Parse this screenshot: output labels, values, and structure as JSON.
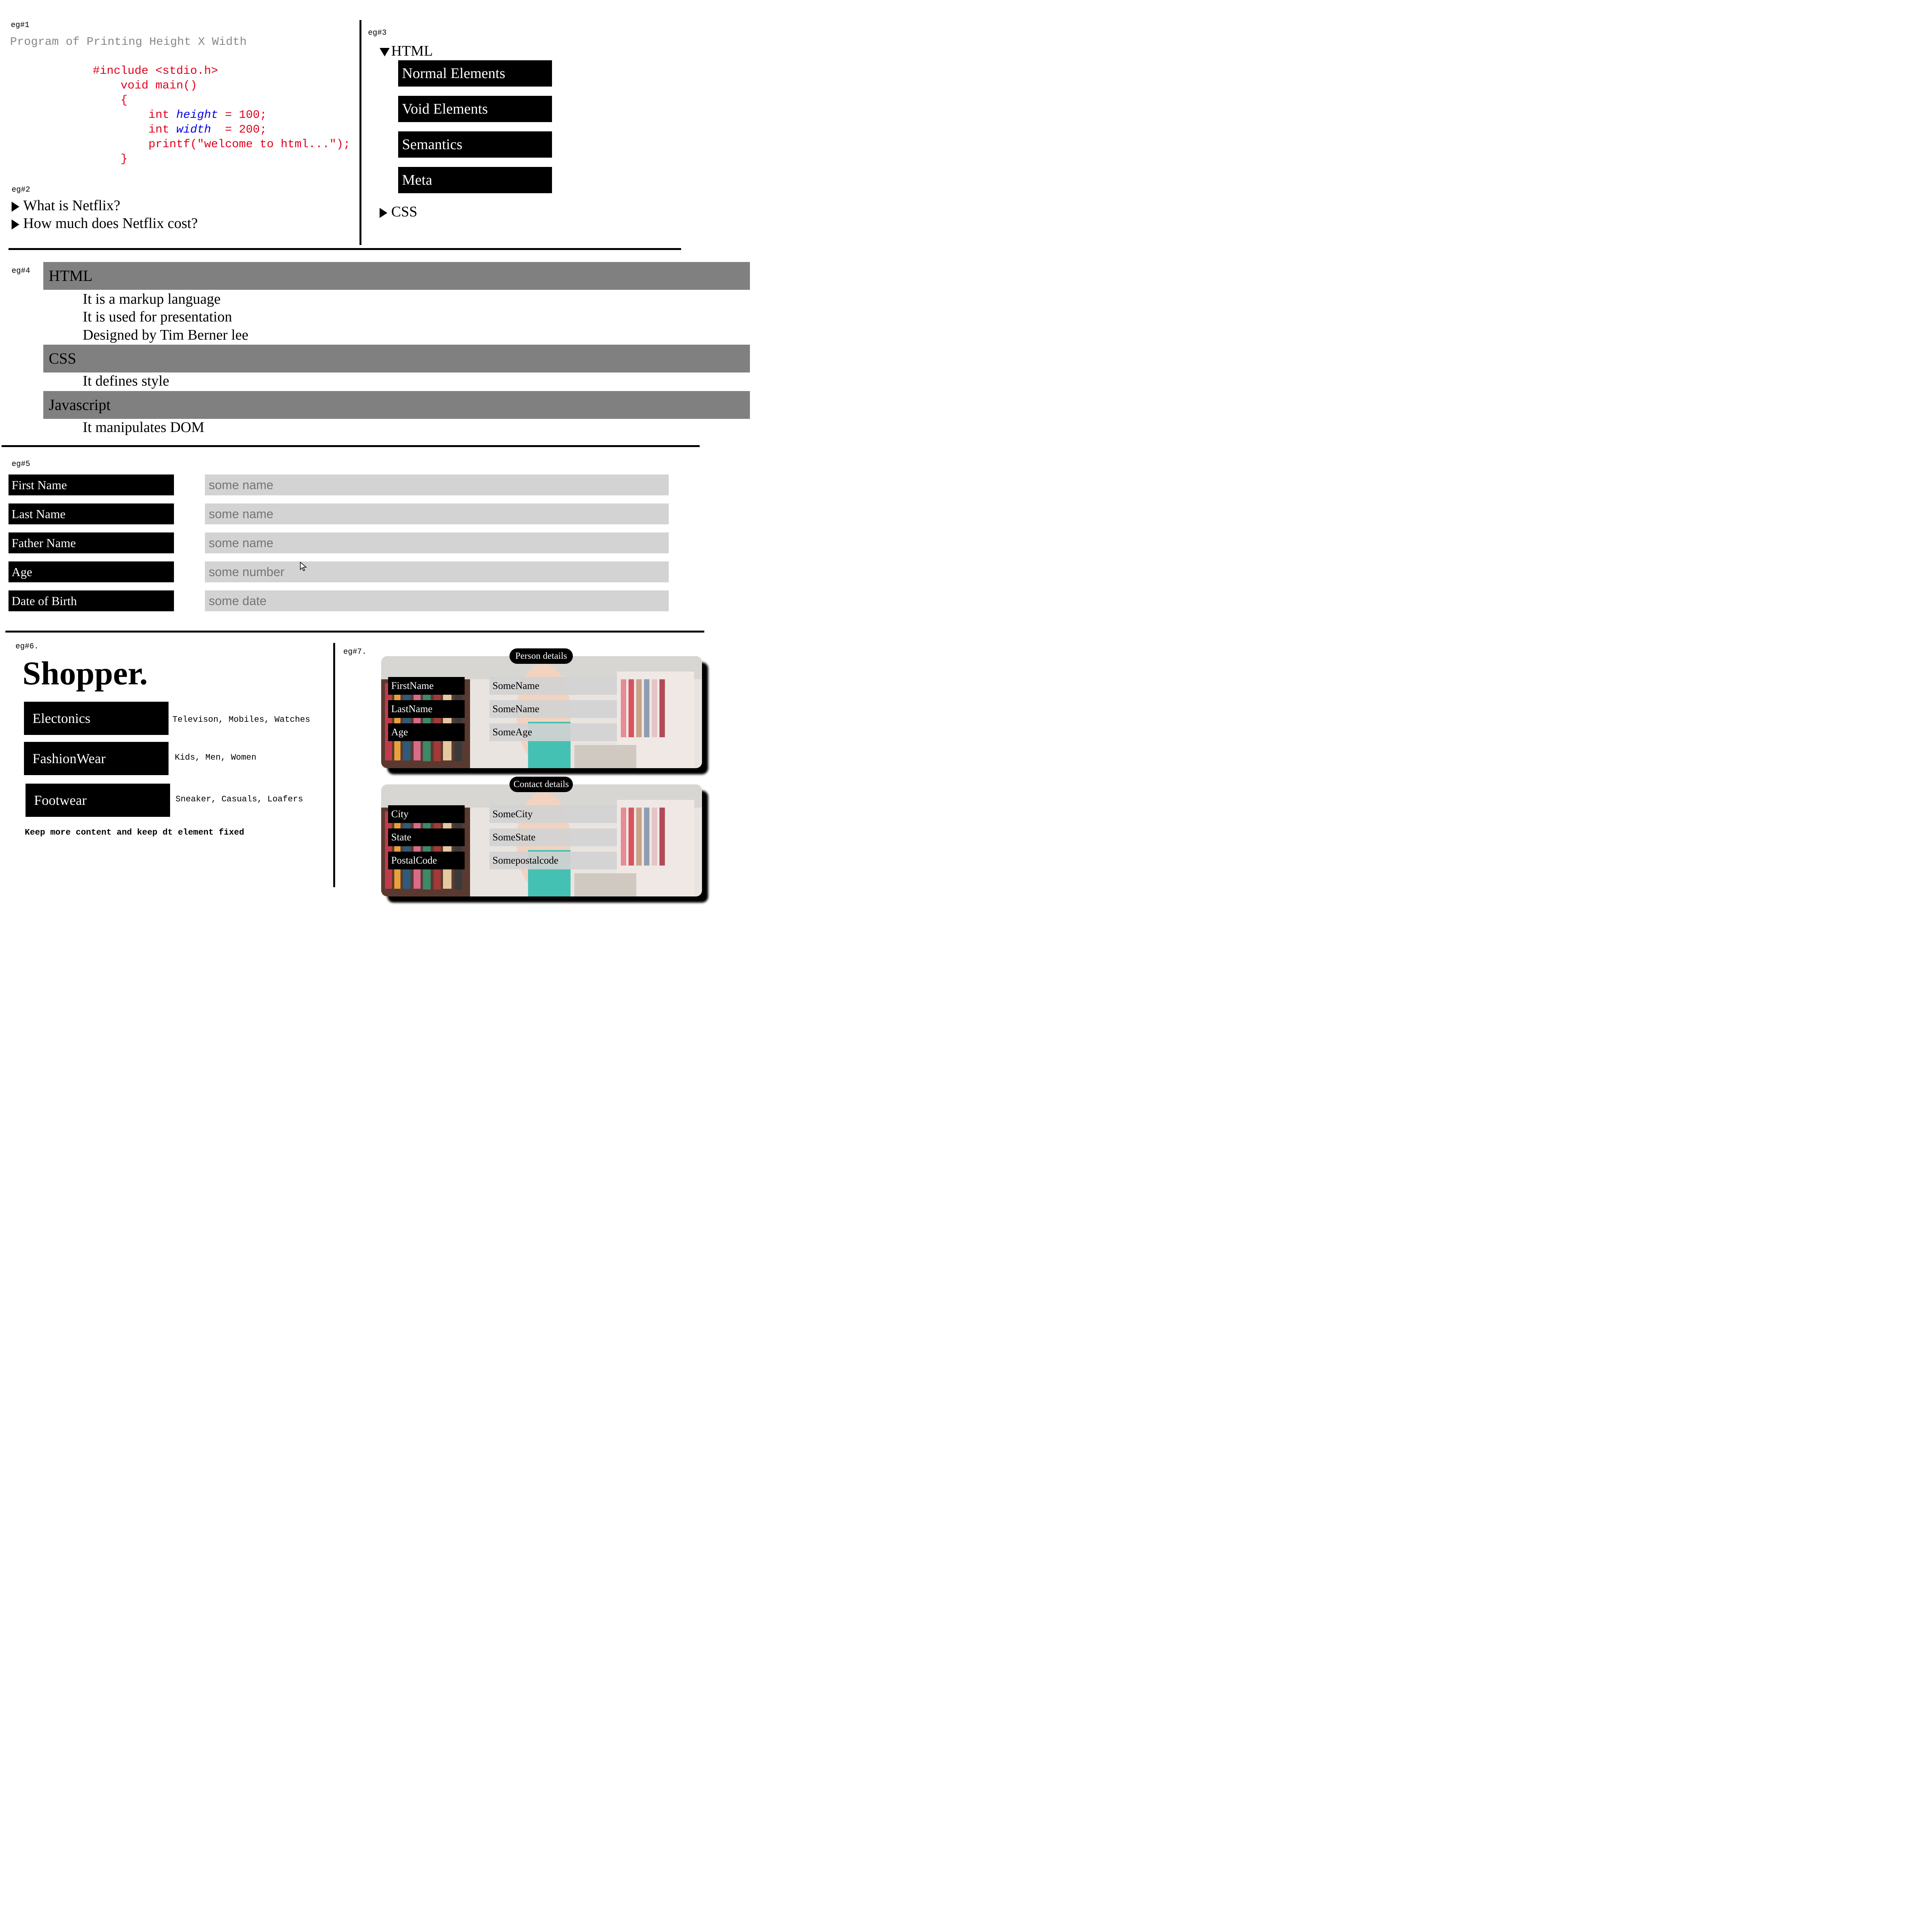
{
  "eg1": {
    "tag": "eg#1",
    "title": "Program of Printing Height X Width",
    "code": {
      "include": "#include <stdio.h>",
      "main": "void main()",
      "open": "{",
      "h_kw": "int ",
      "h_var": "height",
      "h_rest": " = 100;",
      "w_kw": "int ",
      "w_var": "width",
      "w_rest": "  = 200;",
      "printf": "printf(\"welcome to html...\");",
      "close": "}"
    }
  },
  "eg2": {
    "tag": "eg#2",
    "items": [
      "What is Netflix?",
      "How much does Netflix cost?"
    ]
  },
  "eg3": {
    "tag": "eg#3",
    "html_label": "HTML",
    "html_items": [
      "Normal Elements",
      "Void Elements",
      "Semantics",
      "Meta"
    ],
    "css_label": "CSS"
  },
  "eg4": {
    "tag": "eg#4",
    "sections": [
      {
        "title": "HTML",
        "items": [
          "It is a markup language",
          "It is used for presentation",
          "Designed by Tim Berner lee"
        ]
      },
      {
        "title": "CSS",
        "items": [
          "It defines style"
        ]
      },
      {
        "title": "Javascript",
        "items": [
          "It manipulates DOM"
        ]
      }
    ]
  },
  "eg5": {
    "tag": "eg#5",
    "fields": [
      {
        "label": "First Name",
        "placeholder": "some name"
      },
      {
        "label": "Last Name",
        "placeholder": "some name"
      },
      {
        "label": "Father Name",
        "placeholder": "some name"
      },
      {
        "label": "Age",
        "placeholder": "some number"
      },
      {
        "label": "Date of Birth",
        "placeholder": "some date"
      }
    ]
  },
  "eg6": {
    "tag": "eg#6.",
    "brand": "Shopper.",
    "categories": [
      {
        "name": "Electonics",
        "desc": "Televison, Mobiles, Watches"
      },
      {
        "name": "FashionWear",
        "desc": "Kids, Men, Women"
      },
      {
        "name": "Footwear",
        "desc": "Sneaker, Casuals, Loafers"
      }
    ],
    "note": "Keep more content and keep dt element fixed"
  },
  "eg7": {
    "tag": "eg#7.",
    "cards": [
      {
        "title": "Person details",
        "rows": [
          {
            "label": "FirstName",
            "value": "SomeName"
          },
          {
            "label": "LastName",
            "value": "SomeName"
          },
          {
            "label": "Age",
            "value": "SomeAge"
          }
        ]
      },
      {
        "title": "Contact details",
        "rows": [
          {
            "label": "City",
            "value": "SomeCity"
          },
          {
            "label": "State",
            "value": "SomeState"
          },
          {
            "label": "PostalCode",
            "value": "Somepostalcode"
          }
        ]
      }
    ]
  },
  "colors": {
    "accordion_header": "#808080",
    "input_bg": "#d3d3d3",
    "code_text": "#e0001b",
    "code_var": "#0000ee",
    "code_comment": "#888888"
  }
}
